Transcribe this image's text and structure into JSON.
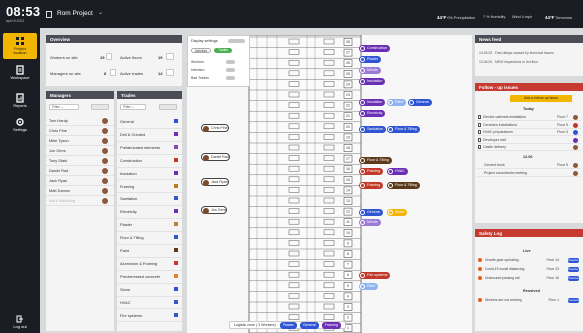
{
  "colors": {
    "accent": "#f2b500",
    "dark": "#1b1d24",
    "blue": "#2f55d4",
    "purple": "#6a2fb5",
    "safety": "#c73a32"
  },
  "topbar": {
    "time": "08:53",
    "date": "april 8 2022",
    "project_title": "Rom Project",
    "chevron": "⌄",
    "weather": [
      {
        "temp": "44°F",
        "text": "0% Precipitation"
      },
      {
        "temp": "",
        "text": "7 % Humidity"
      },
      {
        "temp": "",
        "text": "Wind 4 mph"
      },
      {
        "temp": "44°F",
        "text": "Tomorrow"
      }
    ]
  },
  "sidebar": {
    "items": [
      {
        "label": "Project",
        "label2": "location",
        "icon": "building-icon"
      },
      {
        "label": "Workspace",
        "icon": "workspace-icon"
      },
      {
        "label": "Reports",
        "icon": "reports-icon"
      },
      {
        "label": "Settings",
        "icon": "gear-icon"
      }
    ],
    "logout": "Log out"
  },
  "overview": {
    "title": "Overview",
    "rows": [
      {
        "label": "Workers on site",
        "value": "19"
      },
      {
        "label": "Managers on site",
        "value": "8"
      }
    ],
    "right": [
      {
        "label": "Active floors",
        "value": "19"
      },
      {
        "label": "Active trades",
        "value": "14"
      }
    ]
  },
  "managers": {
    "title": "Managers",
    "filter": "Filter",
    "list": [
      "Tom Hardy",
      "Chris Pine",
      "Mike Tyson",
      "Jon Gens",
      "Tony Stark",
      "Daniel Rad",
      "Jack Ryan",
      "Matt Damon",
      "Mark Wahlberg"
    ]
  },
  "trades": {
    "title": "Trades",
    "filter": "Filter",
    "list": [
      {
        "name": "General",
        "color": "#2f55d4"
      },
      {
        "name": "Drill & Grinded",
        "color": "#6a2fb5"
      },
      {
        "name": "Prefabricated elements",
        "color": "#8e44ad"
      },
      {
        "name": "Construction",
        "color": "#c0392b"
      },
      {
        "name": "Insulation",
        "color": "#6a2fb5"
      },
      {
        "name": "Framing",
        "color": "#c07a1b"
      },
      {
        "name": "Sanitation",
        "color": "#2f55d4"
      },
      {
        "name": "Electricity",
        "color": "#6a2fb5"
      },
      {
        "name": "Plaster",
        "color": "#b08a2e"
      },
      {
        "name": "Floor & Tilling",
        "color": "#2f55d4"
      },
      {
        "name": "Paint",
        "color": "#5d3a1a"
      },
      {
        "name": "Aluminium & Framing",
        "color": "#c0392b"
      },
      {
        "name": "Precheressed concrete",
        "color": "#e67e22"
      },
      {
        "name": "Stone",
        "color": "#2f55d4"
      },
      {
        "name": "HVAC",
        "color": "#2f55d4"
      },
      {
        "name": "Fire systems",
        "color": "#2f55d4"
      }
    ]
  },
  "display": {
    "title": "Display settings",
    "chip_a": "Activities",
    "chip_b": "Trades",
    "toggles": [
      "Workers",
      "Intention",
      "Bad Trades"
    ]
  },
  "workers": [
    {
      "name": "Chris Pine"
    },
    {
      "name": "Daniel Rad"
    },
    {
      "name": "Jack Ryan"
    },
    {
      "name": "Jon Gens"
    }
  ],
  "trade_tags": [
    {
      "floor": "24",
      "label": "Construction",
      "color": "#6a2fb5"
    },
    {
      "floor": "23",
      "label": "Plaster",
      "color": "#2f55d4"
    },
    {
      "floor": "22",
      "label": "Minnie",
      "color": "#9b7bd4"
    },
    {
      "floor": "21",
      "label": "Insulation",
      "color": "#6a2fb5"
    },
    {
      "floor": "20",
      "label": "Insulation",
      "color": "#6a2fb5"
    },
    {
      "floor": "20b",
      "label": "Paint",
      "color": "#8fb3f0"
    },
    {
      "floor": "20c",
      "label": "General",
      "color": "#2f55d4"
    },
    {
      "floor": "19",
      "label": "Electricity",
      "color": "#6a2fb5"
    },
    {
      "floor": "18",
      "label": "Sanitation",
      "color": "#2f55d4"
    },
    {
      "floor": "18b",
      "label": "Floor & Tilling",
      "color": "#2f55d4"
    },
    {
      "floor": "15",
      "label": "Floor & Tilling",
      "color": "#5d3a1a"
    },
    {
      "floor": "14",
      "label": "Framing",
      "color": "#c0392b"
    },
    {
      "floor": "14b",
      "label": "HVAC",
      "color": "#6a2fb5"
    },
    {
      "floor": "13",
      "label": "Framing",
      "color": "#c0392b"
    },
    {
      "floor": "13b",
      "label": "Floor & Tilling",
      "color": "#5d3a1a"
    },
    {
      "floor": "9",
      "label": "General",
      "color": "#2f55d4"
    },
    {
      "floor": "9b",
      "label": "Stone",
      "color": "#f2b500"
    },
    {
      "floor": "8",
      "label": "Minnie",
      "color": "#9b7bd4"
    },
    {
      "floor": "3",
      "label": "Fire systems",
      "color": "#c0392b"
    },
    {
      "floor": "2",
      "label": "Paint",
      "color": "#8fb3f0"
    }
  ],
  "legend": {
    "title": "Logistic zone ( 3 Workers)",
    "items": [
      "Plaster",
      "General",
      "Framing"
    ]
  },
  "news": {
    "title": "News feed",
    "rows": [
      {
        "time": "14.06.20",
        "text": "Fast delays caused by technical issues"
      },
      {
        "time": "13.06.20",
        "text": "MEW inspections in 3rd floor"
      }
    ]
  },
  "followup": {
    "title": "Follow - up issues",
    "button": "Add a follow up issue",
    "today": "Today",
    "date2": "12.06",
    "rows": [
      {
        "text": "Electric cabinets installation",
        "floor": "Floor 7"
      },
      {
        "text": "Ceramics installations",
        "floor": "Floor 5"
      },
      {
        "text": "HVAC preparations",
        "floor": "Floor 3"
      },
      {
        "text": "Developer visit",
        "floor": ""
      },
      {
        "text": "Castle delivery",
        "floor": ""
      }
    ],
    "rows2": [
      {
        "text": "Cement truck",
        "floor": "Floor 5"
      },
      {
        "text": "Project consultants meeting",
        "floor": ""
      }
    ]
  },
  "safety": {
    "title": "Safety Log",
    "live": "Live",
    "resolved": "Resolved",
    "rows": [
      {
        "text": "Unsafe gear operating",
        "floor": "Floor 14",
        "status": "Resolve"
      },
      {
        "text": "Covid-19 social distancing",
        "floor": "Floor 23",
        "status": "Resolve"
      },
      {
        "text": "Unsecured passing rail",
        "floor": "Floor 16",
        "status": "Resolve"
      }
    ],
    "resolved_rows": [
      {
        "text": "Workers are not working",
        "floor": "Floor 1",
        "status": "General"
      }
    ]
  }
}
